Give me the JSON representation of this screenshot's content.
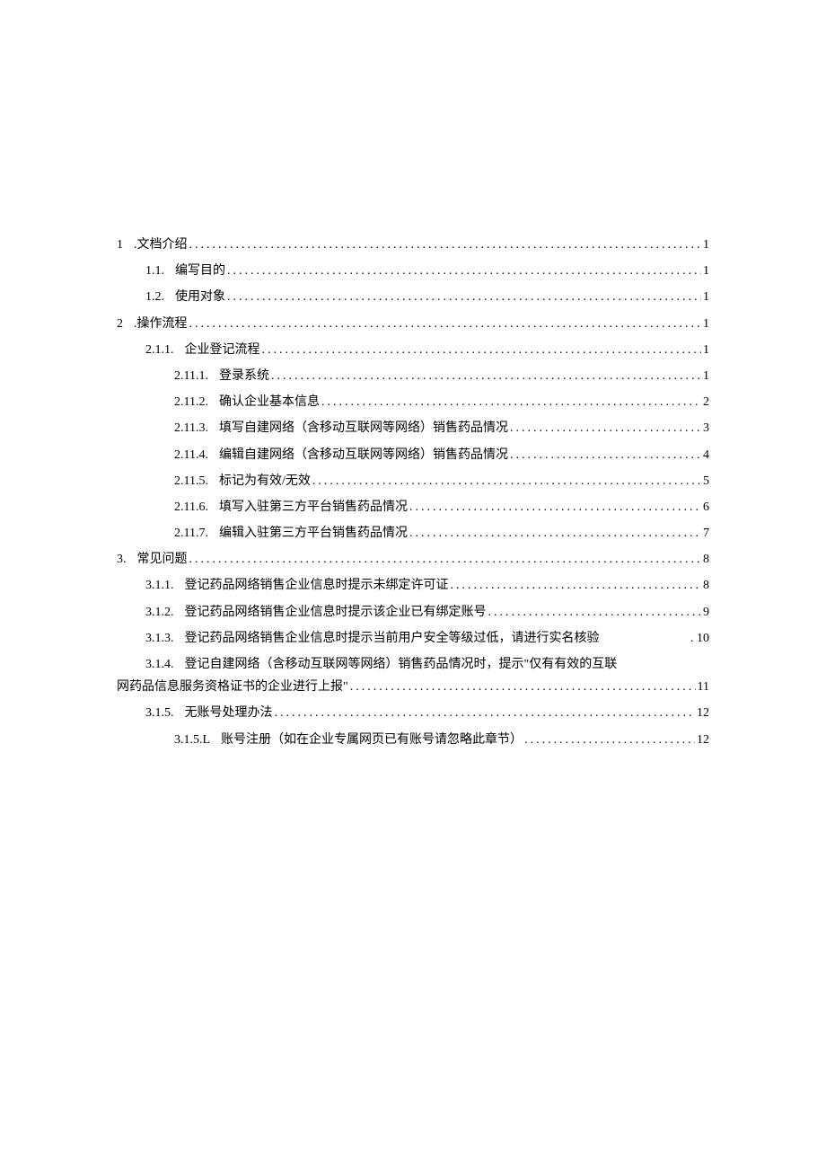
{
  "toc": [
    {
      "indent": 0,
      "num": "1",
      "suffix": "  .",
      "title": "文档介绍",
      "page": "1"
    },
    {
      "indent": 1,
      "num": "1.1.",
      "suffix": "",
      "title": "编写目的",
      "page": "1"
    },
    {
      "indent": 1,
      "num": "1.2.",
      "suffix": "",
      "title": "使用对象",
      "page": "1"
    },
    {
      "indent": 0,
      "num": "2",
      "suffix": "  .",
      "title": "操作流程",
      "page": "1"
    },
    {
      "indent": 1,
      "num": "2.1.1.",
      "suffix": "",
      "title": "企业登记流程",
      "page": "1"
    },
    {
      "indent": 2,
      "num": "2.11.1.",
      "suffix": "",
      "title": "登录系统",
      "page": "1"
    },
    {
      "indent": 2,
      "num": "2.11.2.",
      "suffix": "",
      "title": "确认企业基本信息",
      "page": "2"
    },
    {
      "indent": 2,
      "num": "2.11.3.",
      "suffix": "",
      "title": "填写自建网络（含移动互联网等网络）销售药品情况",
      "page": "3"
    },
    {
      "indent": 2,
      "num": "2.11.4.",
      "suffix": "",
      "title": "编辑自建网络（含移动互联网等网络）销售药品情况",
      "page": "4"
    },
    {
      "indent": 2,
      "num": "2.11.5.",
      "suffix": "",
      "title": "标记为有效/无效",
      "page": "5"
    },
    {
      "indent": 2,
      "num": "2.11.6.",
      "suffix": "",
      "title": "填写入驻第三方平台销售药品情况",
      "page": "6"
    },
    {
      "indent": 2,
      "num": "2.11.7.",
      "suffix": "",
      "title": "编辑入驻第三方平台销售药品情况",
      "page": "7"
    },
    {
      "indent": 0,
      "num": "3.",
      "suffix": "",
      "title": "常见问题",
      "page": "8"
    },
    {
      "indent": 1,
      "num": "3.1.1.",
      "suffix": "",
      "title": "登记药品网络销售企业信息时提示未绑定许可证",
      "page": "8"
    },
    {
      "indent": 1,
      "num": "3.1.2.",
      "suffix": "",
      "title": "登记药品网络销售企业信息时提示该企业已有绑定账号",
      "page": "9"
    },
    {
      "indent": 1,
      "num": "3.1.3.",
      "suffix": "",
      "title": "登记药品网络销售企业信息时提示当前用户安全等级过低，请进行实名核验",
      "page": ". 10",
      "nodots": true
    },
    {
      "indent": 1,
      "num": "3.1.4.",
      "suffix": "",
      "wrap": true,
      "line1": "登记自建网络（含移动互联网等网络）销售药品情况时，提示\"仅有有效的互联",
      "line2": "网药品信息服务资格证书的企业进行上报\"",
      "page": "11"
    },
    {
      "indent": 1,
      "num": "3.1.5.",
      "suffix": "",
      "title": "无账号处理办法",
      "page": "12"
    },
    {
      "indent": 2,
      "num": "3.1.5.L",
      "suffix": " ",
      "title": "账号注册（如在企业专属网页已有账号请忽略此章节）",
      "page": "12"
    }
  ]
}
